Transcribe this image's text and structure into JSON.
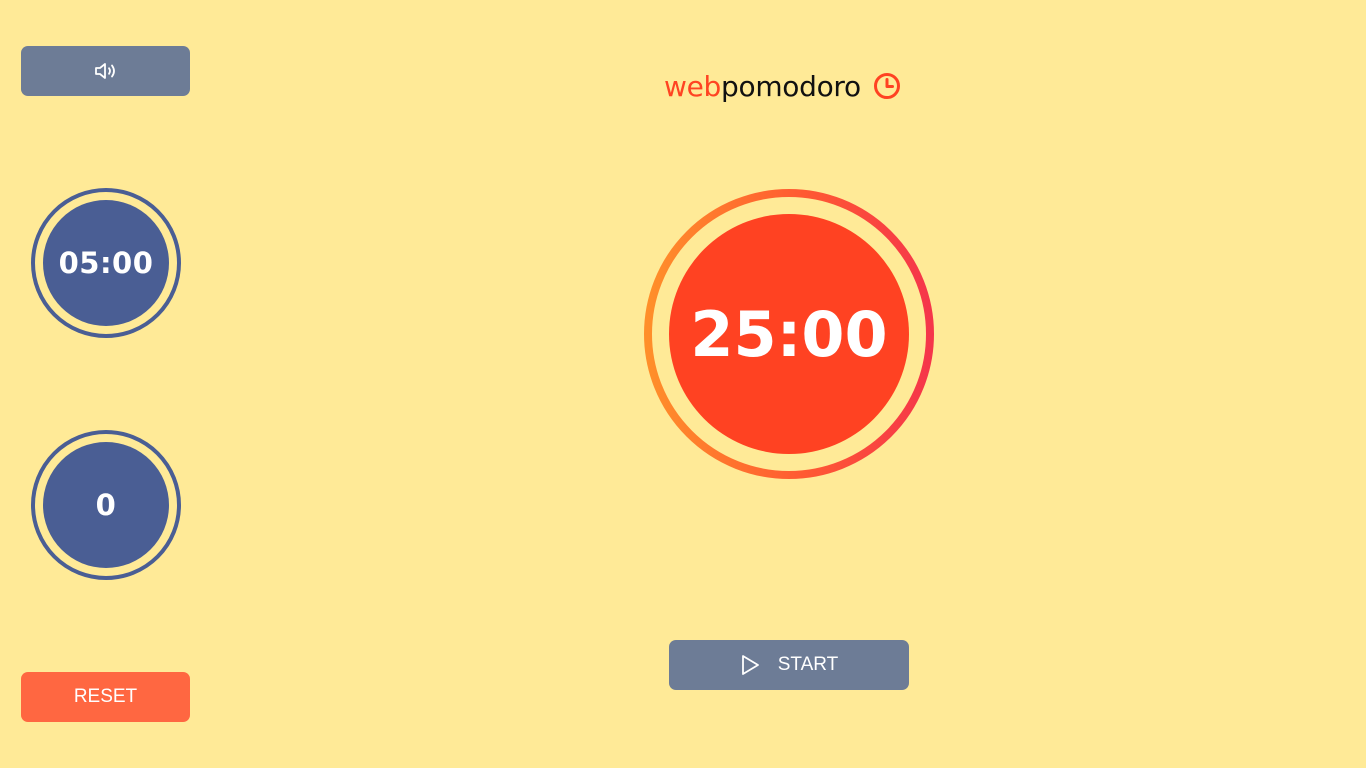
{
  "controls": {
    "sound_icon": "speaker-volume-icon",
    "reset_label": "RESET",
    "start_label": "START",
    "play_icon": "play-icon"
  },
  "side_stats": {
    "break_time": "05:00",
    "pomodoro_count": "0"
  },
  "logo": {
    "part1": "web",
    "part2": "pomodoro",
    "icon": "clock-icon"
  },
  "timer": {
    "display": "25:00"
  },
  "colors": {
    "background": "#ffea97",
    "accent": "#ff4222",
    "secondary": "#4a5e94",
    "button": "#6d7c96",
    "reset": "#ff6741"
  }
}
